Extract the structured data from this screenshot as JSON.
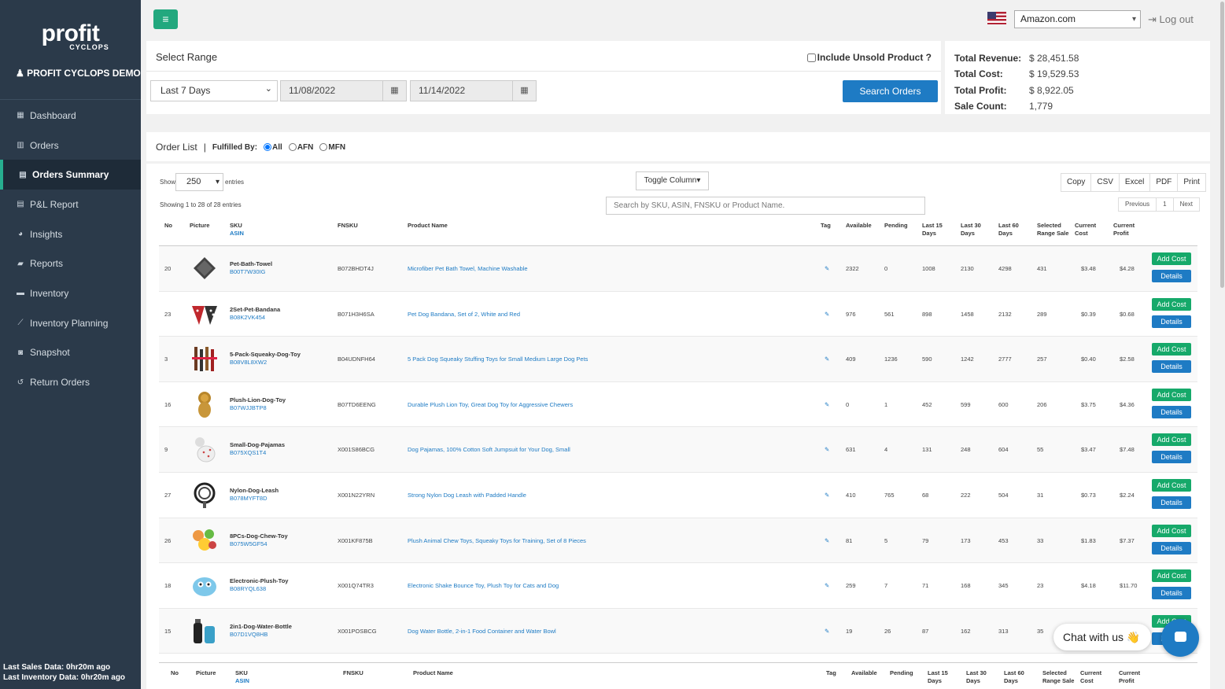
{
  "app": {
    "logo": "profit",
    "logo_sub": "CYCLOPS",
    "user": "PROFIT CYCLOPS DEMO"
  },
  "nav": [
    {
      "label": "Dashboard",
      "icon": "grid-icon",
      "glyph": "▦"
    },
    {
      "label": "Orders",
      "icon": "bar-chart-icon",
      "glyph": "▥"
    },
    {
      "label": "Orders Summary",
      "icon": "table-icon",
      "glyph": "▤"
    },
    {
      "label": "P&L Report",
      "icon": "table-icon",
      "glyph": "▤"
    },
    {
      "label": "Insights",
      "icon": "pie-chart-icon",
      "glyph": "◕"
    },
    {
      "label": "Reports",
      "icon": "book-icon",
      "glyph": "▰"
    },
    {
      "label": "Inventory",
      "icon": "briefcase-icon",
      "glyph": "▬"
    },
    {
      "label": "Inventory Planning",
      "icon": "line-chart-icon",
      "glyph": "⟋"
    },
    {
      "label": "Snapshot",
      "icon": "camera-icon",
      "glyph": "◙"
    },
    {
      "label": "Return Orders",
      "icon": "undo-icon",
      "glyph": "↺"
    }
  ],
  "sidebar_footer": {
    "sales": "Last Sales Data: 0hr20m ago",
    "inventory": "Last Inventory Data: 0hr20m ago"
  },
  "header": {
    "marketplace": "Amazon.com",
    "logout": "Log out",
    "menu_glyph": "≡",
    "logout_glyph": "⇥"
  },
  "range": {
    "title": "Select Range",
    "preset": "Last 7 Days",
    "start": "11/08/2022",
    "end": "11/14/2022",
    "unsold": "Include Unsold Product ?",
    "search_button": "Search Orders",
    "cal_glyph": "▦",
    "chev": "⌄"
  },
  "totals": [
    {
      "k": "Total Revenue:",
      "v": "$ 28,451.58"
    },
    {
      "k": "Total Cost:",
      "v": "$ 19,529.53"
    },
    {
      "k": "Total Profit:",
      "v": "$ 8,922.05"
    },
    {
      "k": "Sale Count:",
      "v": "1,779"
    }
  ],
  "orders": {
    "title": "Order List",
    "sep": "|",
    "fulfilled_by": "Fulfilled By:",
    "options": [
      "All",
      "AFN",
      "MFN"
    ]
  },
  "table_controls": {
    "show": "Show",
    "length": "250",
    "entries": "entries",
    "info": "Showing 1 to 28 of 28 entries",
    "toggle": "Toggle Column",
    "export": [
      "Copy",
      "CSV",
      "Excel",
      "PDF",
      "Print"
    ],
    "search_placeholder": "Search by SKU, ASIN, FNSKU or Product Name.",
    "pager": [
      "Previous",
      "1",
      "Next"
    ]
  },
  "columns": {
    "no": "No",
    "picture": "Picture",
    "sku": "SKU",
    "asin": "ASIN",
    "fnsku": "FNSKU",
    "product": "Product Name",
    "tag": "Tag",
    "available": "Available",
    "pending": "Pending",
    "l15a": "Last 15",
    "l15b": "Days",
    "l30a": "Last 30",
    "l30b": "Days",
    "l60a": "Last 60",
    "l60b": "Days",
    "sela": "Selected",
    "selb": "Range Sale",
    "costa": "Current",
    "costb": "Cost",
    "profa": "Current",
    "profb": "Profit"
  },
  "buttons": {
    "add_cost": "Add Cost",
    "details": "Details"
  },
  "rows": [
    {
      "no": "20",
      "sku": "Pet-Bath-Towel",
      "asin": "B00T7W30IG",
      "fnsku": "B072BHDT4J",
      "name": "Microfiber Pet Bath Towel, Machine Washable",
      "available": "2322",
      "pending": "0",
      "l15": "1008",
      "l30": "2130",
      "l60": "4298",
      "sel": "431",
      "cost": "$3.48",
      "profit": "$4.28",
      "pic": "towel"
    },
    {
      "no": "23",
      "sku": "2Set-Pet-Bandana",
      "asin": "B08K2VK454",
      "fnsku": "B071H3H6SA",
      "name": "Pet Dog Bandana, Set of 2, White and Red",
      "available": "976",
      "pending": "561",
      "l15": "898",
      "l30": "1458",
      "l60": "2132",
      "sel": "289",
      "cost": "$0.39",
      "profit": "$0.68",
      "pic": "bandana"
    },
    {
      "no": "3",
      "sku": "5-Pack-Squeaky-Dog-Toy",
      "asin": "B08V8L8XW2",
      "fnsku": "B04UDNFH64",
      "name": "5 Pack Dog Squeaky Stuffing Toys for Small Medium Large Dog Pets",
      "available": "409",
      "pending": "1236",
      "l15": "590",
      "l30": "1242",
      "l60": "2777",
      "sel": "257",
      "cost": "$0.40",
      "profit": "$2.58",
      "pic": "toys"
    },
    {
      "no": "16",
      "sku": "Plush-Lion-Dog-Toy",
      "asin": "B07WJJBTP8",
      "fnsku": "B07TD6EENG",
      "name": "Durable Plush Lion Toy, Great Dog Toy for Aggressive Chewers",
      "available": "0",
      "pending": "1",
      "l15": "452",
      "l30": "599",
      "l60": "600",
      "sel": "206",
      "cost": "$3.75",
      "profit": "$4.36",
      "pic": "lion"
    },
    {
      "no": "9",
      "sku": "Small-Dog-Pajamas",
      "asin": "B075XQS1T4",
      "fnsku": "X001S86BCG",
      "name": "Dog Pajamas, 100% Cotton Soft Jumpsuit for Your Dog, Small",
      "available": "631",
      "pending": "4",
      "l15": "131",
      "l30": "248",
      "l60": "604",
      "sel": "55",
      "cost": "$3.47",
      "profit": "$7.48",
      "pic": "pajamas"
    },
    {
      "no": "27",
      "sku": "Nylon-Dog-Leash",
      "asin": "B078MYFT8D",
      "fnsku": "X001N22YRN",
      "name": "Strong Nylon Dog Leash with Padded Handle",
      "available": "410",
      "pending": "765",
      "l15": "68",
      "l30": "222",
      "l60": "504",
      "sel": "31",
      "cost": "$0.73",
      "profit": "$2.24",
      "pic": "leash"
    },
    {
      "no": "26",
      "sku": "8PCs-Dog-Chew-Toy",
      "asin": "B075W5GF54",
      "fnsku": "X001KF875B",
      "name": "Plush Animal Chew Toys, Squeaky Toys for Training, Set of 8 Pieces",
      "available": "81",
      "pending": "5",
      "l15": "79",
      "l30": "173",
      "l60": "453",
      "sel": "33",
      "cost": "$1.83",
      "profit": "$7.37",
      "pic": "chew"
    },
    {
      "no": "18",
      "sku": "Electronic-Plush-Toy",
      "asin": "B08RYQL638",
      "fnsku": "X001Q74TR3",
      "name": "Electronic Shake Bounce Toy, Plush Toy for Cats and Dog",
      "available": "259",
      "pending": "7",
      "l15": "71",
      "l30": "168",
      "l60": "345",
      "sel": "23",
      "cost": "$4.18",
      "profit": "$11.70",
      "pic": "electronic"
    },
    {
      "no": "15",
      "sku": "2in1-Dog-Water-Bottle",
      "asin": "B07D1VQ8HB",
      "fnsku": "X001POSBCG",
      "name": "Dog Water Bottle, 2-in-1 Food Container and Water Bowl",
      "available": "19",
      "pending": "26",
      "l15": "87",
      "l30": "162",
      "l60": "313",
      "sel": "35",
      "cost": "",
      "profit": "",
      "pic": "bottle"
    }
  ],
  "chat": {
    "label": "Chat with us 👋"
  },
  "colors": {
    "sidebar": "#2b3a4a",
    "accent": "#22a87e",
    "primary": "#1e7bc4",
    "add_cost": "#16a96a"
  }
}
